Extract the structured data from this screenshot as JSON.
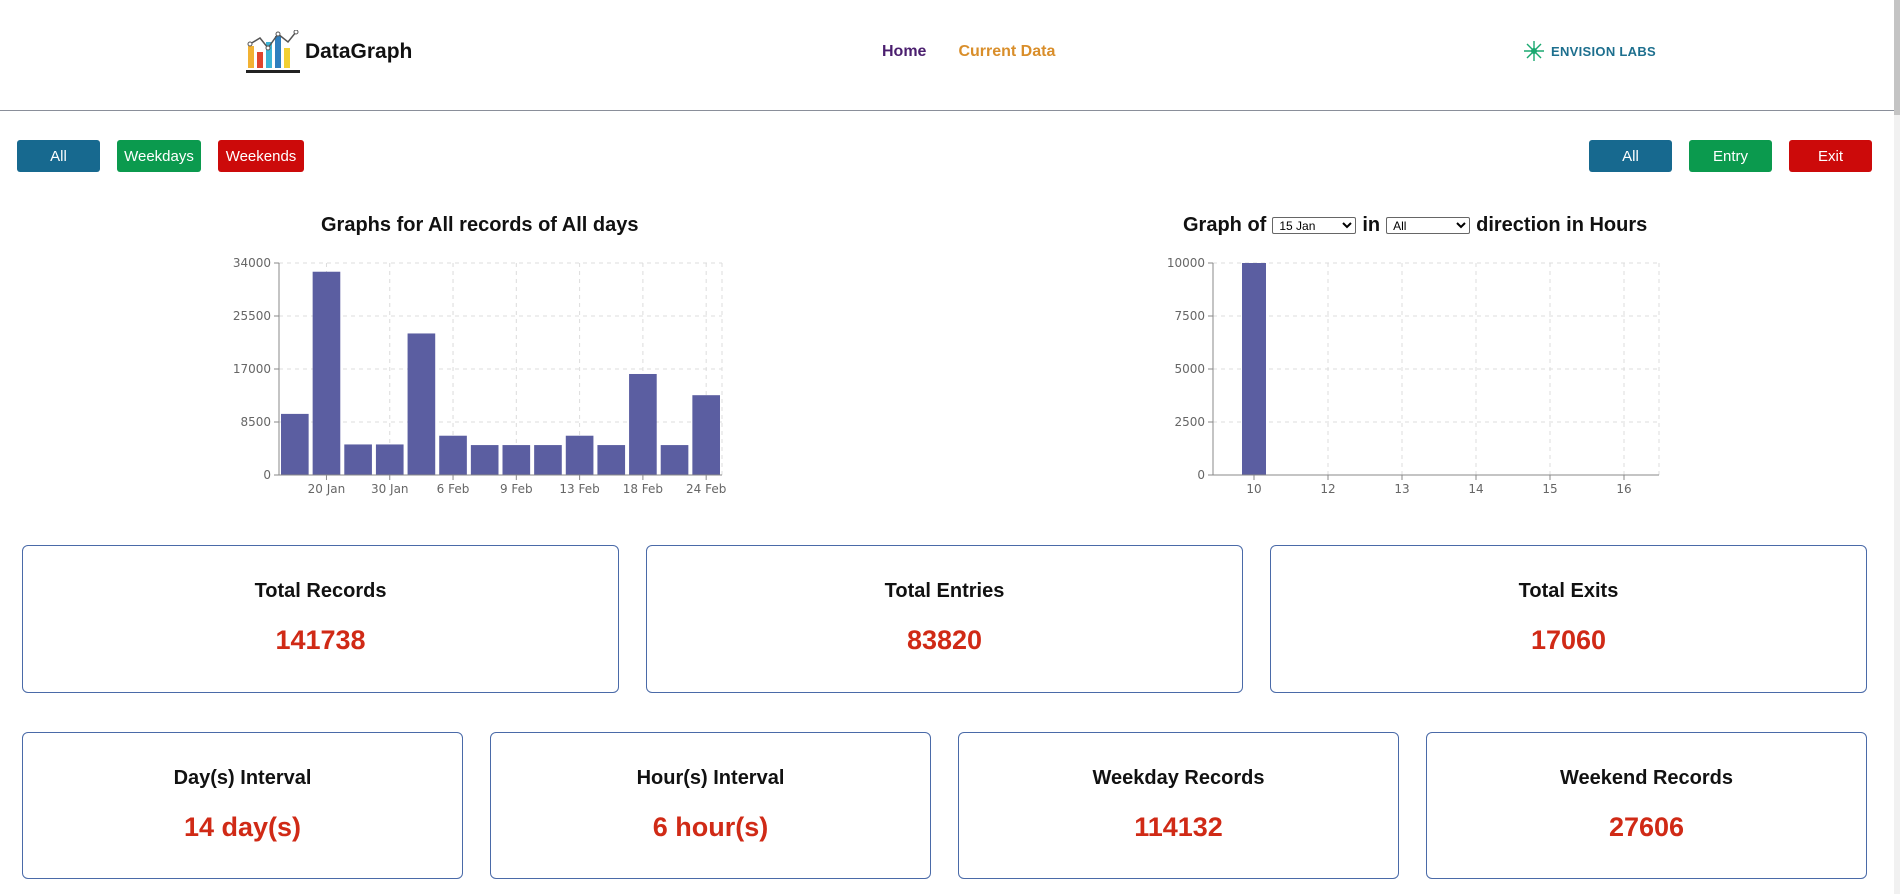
{
  "brand": {
    "name": "DataGraph"
  },
  "nav": {
    "home": "Home",
    "current": "Current Data"
  },
  "partner": {
    "name": "ENVISION LABS"
  },
  "day_filters": {
    "all": "All",
    "weekdays": "Weekdays",
    "weekends": "Weekends"
  },
  "direction_filters": {
    "all": "All",
    "entry": "Entry",
    "exit": "Exit"
  },
  "left_chart": {
    "title": "Graphs for All records of All days"
  },
  "right_chart": {
    "title_prefix": "Graph of",
    "title_in": "in",
    "title_suffix": "direction in Hours",
    "date_select": "15 Jan",
    "direction_select": "All"
  },
  "stats_top": [
    {
      "label": "Total Records",
      "value": "141738"
    },
    {
      "label": "Total Entries",
      "value": "83820"
    },
    {
      "label": "Total Exits",
      "value": "17060"
    }
  ],
  "stats_bottom": [
    {
      "label": "Day(s) Interval",
      "value": "14 day(s)"
    },
    {
      "label": "Hour(s) Interval",
      "value": "6 hour(s)"
    },
    {
      "label": "Weekday Records",
      "value": "114132"
    },
    {
      "label": "Weekend Records",
      "value": "27606"
    }
  ],
  "colors": {
    "bar": "#5b5ea1",
    "blue": "#17698f",
    "green": "#0b9a4e",
    "red": "#cc0a0a",
    "value": "#d02a16"
  },
  "chart_data": [
    {
      "type": "bar",
      "title": "Graphs for All records of All days",
      "xticks": [
        "20 Jan",
        "30 Jan",
        "6 Feb",
        "9 Feb",
        "13 Feb",
        "18 Feb",
        "24 Feb"
      ],
      "yticks": [
        0,
        8500,
        17000,
        25500,
        34000
      ],
      "ylim": [
        0,
        34000
      ],
      "values": [
        9800,
        32600,
        4900,
        4900,
        22700,
        6300,
        4800,
        4800,
        4800,
        6300,
        4800,
        16200,
        4800,
        12800
      ],
      "grid": true
    },
    {
      "type": "bar",
      "title": "Graph of 15 Jan in All direction in Hours",
      "xticks": [
        "10",
        "12",
        "13",
        "14",
        "15",
        "16"
      ],
      "yticks": [
        0,
        2500,
        5000,
        7500,
        10000
      ],
      "ylim": [
        0,
        10000
      ],
      "values": [
        10000,
        0,
        0,
        0,
        0,
        0
      ],
      "grid": true
    }
  ]
}
